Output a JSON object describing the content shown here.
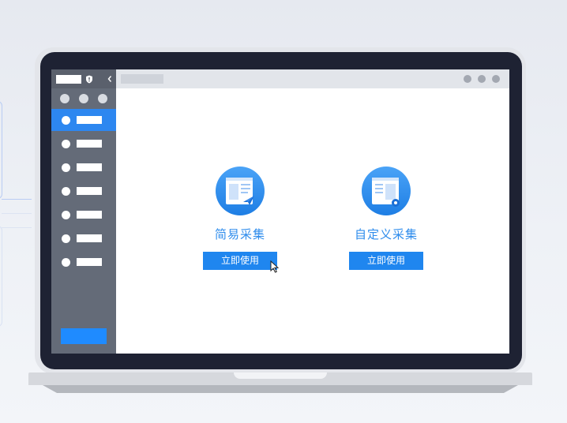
{
  "window": {
    "title_tab": "",
    "window_controls": [
      "dot-icon",
      "dot-icon",
      "dot-icon"
    ]
  },
  "sidebar": {
    "header_icons": [
      "shield-icon",
      "chevron-left-icon"
    ],
    "status_dots": 3,
    "items": [
      {
        "label": "",
        "active": true
      },
      {
        "label": "",
        "active": false
      },
      {
        "label": "",
        "active": false
      },
      {
        "label": "",
        "active": false
      },
      {
        "label": "",
        "active": false
      },
      {
        "label": "",
        "active": false
      },
      {
        "label": "",
        "active": false
      }
    ],
    "bottom_button_label": ""
  },
  "main": {
    "cards": [
      {
        "title": "简易采集",
        "button_label": "立即使用",
        "icon": "simple-collect-icon"
      },
      {
        "title": "自定义采集",
        "button_label": "立即使用",
        "icon": "custom-collect-icon"
      }
    ]
  },
  "colors": {
    "accent": "#1f86ef",
    "title_text": "#2e8cec",
    "sidebar_bg": "#646b78",
    "bezel": "#1e2233"
  }
}
